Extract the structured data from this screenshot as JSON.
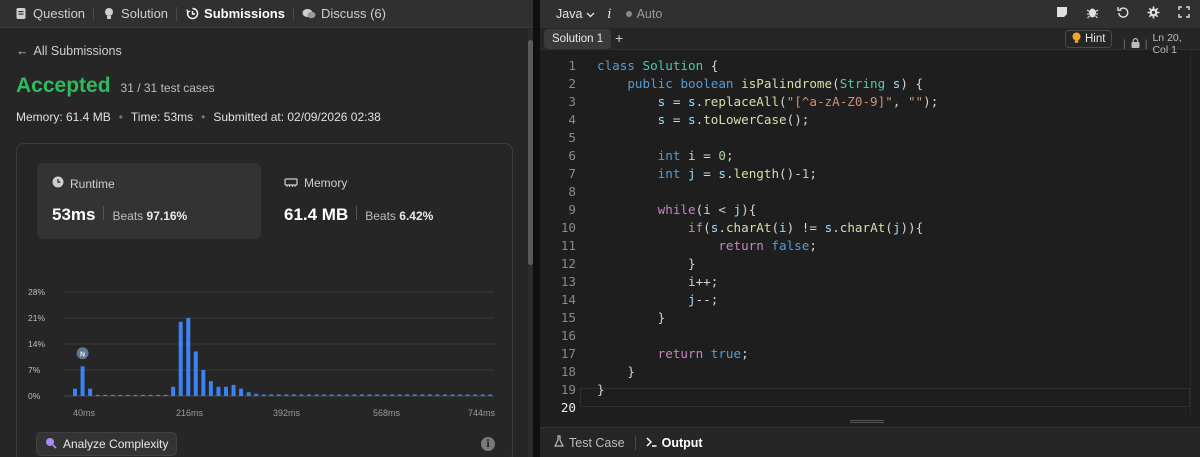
{
  "tabs": [
    {
      "icon": "document-icon",
      "label": "Question"
    },
    {
      "icon": "lightbulb-icon",
      "label": "Solution"
    },
    {
      "icon": "history-icon",
      "label": "Submissions"
    },
    {
      "icon": "chat-icon",
      "label": "Discuss (6)"
    }
  ],
  "submission": {
    "back_label": "All Submissions",
    "status": "Accepted",
    "tests": "31 / 31 test cases",
    "memory": "Memory: 61.4 MB",
    "time": "Time: 53ms",
    "submitted": "Submitted at: 02/09/2026 02:38",
    "colors": {
      "accepted": "#2cbb5d",
      "bar": "#3b82f6"
    }
  },
  "runtime": {
    "title": "Runtime",
    "value": "53ms",
    "beats_prefix": "Beats ",
    "beats_value": "97.16%"
  },
  "memory_stat": {
    "title": "Memory",
    "value": "61.4 MB",
    "beats_prefix": "Beats ",
    "beats_value": "6.42%"
  },
  "chart_data": {
    "type": "bar",
    "title": "",
    "xlabel": "",
    "ylabel": "",
    "ylim": [
      0,
      28
    ],
    "yticks": [
      "0%",
      "7%",
      "14%",
      "21%",
      "28%"
    ],
    "xtick_labels": [
      "40ms",
      "216ms",
      "392ms",
      "568ms",
      "744ms"
    ],
    "marker_label": "N",
    "values": [
      2,
      8,
      2,
      0.3,
      0.3,
      0.3,
      0.3,
      0.3,
      0.3,
      0.3,
      0.3,
      0.3,
      0.3,
      2.5,
      20,
      21,
      12,
      7,
      4,
      2.5,
      2.5,
      3,
      2,
      1,
      0.6,
      0.4,
      0.4,
      0.4,
      0.4,
      0.4,
      0.4,
      0.4,
      0.4,
      0.4,
      0.4,
      0.4,
      0.4,
      0.4,
      0.4,
      0.4,
      0.4,
      0.4,
      0.4,
      0.4,
      0.4,
      0.4,
      0.4,
      0.4,
      0.4,
      0.4,
      0.4,
      0.4,
      0.4,
      0.4,
      0.4,
      0.4
    ],
    "grid": true
  },
  "analyze_label": "Analyze Complexity",
  "editor": {
    "language": "Java",
    "italic_glyph": "i",
    "auto_label": "Auto",
    "solution_tab": "Solution 1",
    "add_tab": "+",
    "hint_label": "Hint",
    "cursor_position": "Ln 20, Col 1",
    "line_numbers": [
      "1",
      "2",
      "3",
      "4",
      "5",
      "6",
      "7",
      "8",
      "9",
      "10",
      "11",
      "12",
      "13",
      "14",
      "15",
      "16",
      "17",
      "18",
      "19",
      "20"
    ]
  },
  "bottom": {
    "test_case": "Test Case",
    "output": "Output"
  }
}
